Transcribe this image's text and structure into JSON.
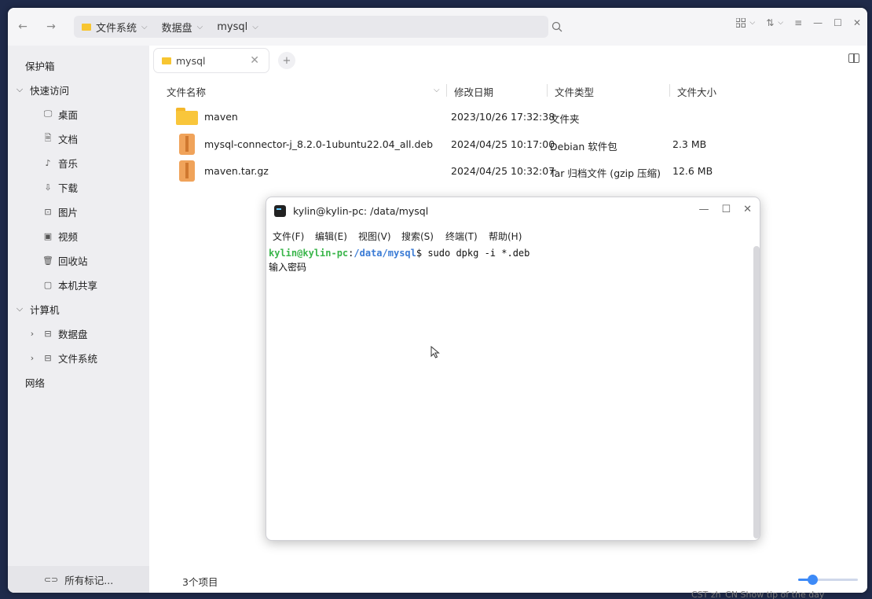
{
  "file_manager": {
    "breadcrumbs": [
      "文件系统",
      "数据盘",
      "mysql"
    ],
    "tab": {
      "label": "mysql"
    },
    "sidebar": {
      "items": [
        {
          "label": "保护箱",
          "icon": ""
        },
        {
          "label": "快速访问",
          "icon": "chevron-down-icon"
        },
        {
          "label": "桌面",
          "icon": "desktop-icon"
        },
        {
          "label": "文档",
          "icon": "document-icon"
        },
        {
          "label": "音乐",
          "icon": "music-icon"
        },
        {
          "label": "下载",
          "icon": "download-icon"
        },
        {
          "label": "图片",
          "icon": "picture-icon"
        },
        {
          "label": "视频",
          "icon": "video-icon"
        },
        {
          "label": "回收站",
          "icon": "trash-icon"
        },
        {
          "label": "本机共享",
          "icon": "share-icon"
        },
        {
          "label": "计算机",
          "icon": "chevron-down-icon"
        },
        {
          "label": "数据盘",
          "icon": "drive-icon"
        },
        {
          "label": "文件系统",
          "icon": "drive-icon"
        },
        {
          "label": "网络",
          "icon": ""
        }
      ],
      "footer": "所有标记..."
    },
    "columns": {
      "name": "文件名称",
      "modified": "修改日期",
      "type": "文件类型",
      "size": "文件大小"
    },
    "files": [
      {
        "name": "maven",
        "modified": "2023/10/26 17:32:38",
        "type": "文件夹",
        "size": "",
        "icon": "folder-icon"
      },
      {
        "name": "mysql-connector-j_8.2.0-1ubuntu22.04_all.deb",
        "modified": "2024/04/25 10:17:00",
        "type": "Debian 软件包",
        "size": "2.3 MB",
        "icon": "package-icon"
      },
      {
        "name": "maven.tar.gz",
        "modified": "2024/04/25 10:32:07",
        "type": "Tar 归档文件 (gzip 压缩)",
        "size": "12.6 MB",
        "icon": "archive-icon"
      }
    ],
    "status": {
      "count": "3个项目"
    },
    "zoom_level": 0.24
  },
  "terminal": {
    "title": "kylin@kylin-pc: /data/mysql",
    "menu": [
      "文件(F)",
      "编辑(E)",
      "视图(V)",
      "搜索(S)",
      "终端(T)",
      "帮助(H)"
    ],
    "prompt_user": "kylin@kylin-pc",
    "prompt_sep": ":",
    "prompt_path": "/data/mysql",
    "command": "$ sudo dpkg -i *.deb",
    "output": "输入密码"
  },
  "taskbar_peek": "CST  zh_CN  Show tip of the day"
}
